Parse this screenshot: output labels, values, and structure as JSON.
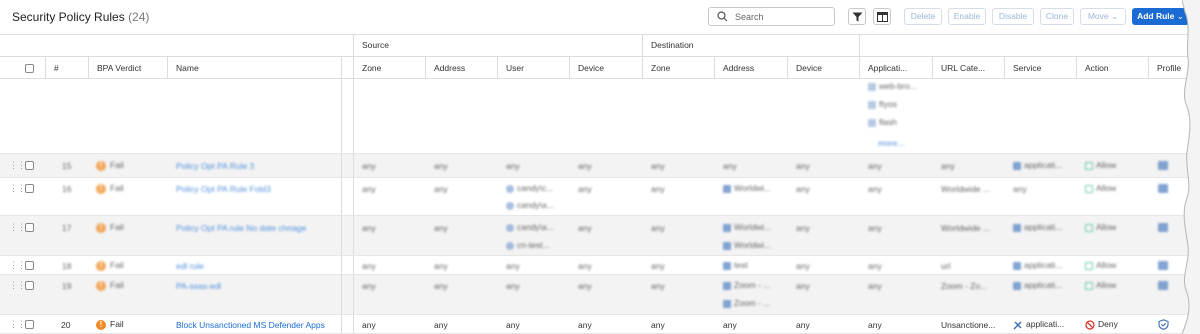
{
  "header": {
    "title": "Security Policy Rules",
    "count": "(24)",
    "search_placeholder": "Search",
    "buttons": {
      "delete": "Delete",
      "enable": "Enable",
      "disable": "Disable",
      "clone": "Clone",
      "move": "Move",
      "add_rule": "Add Rule"
    }
  },
  "groups": {
    "source": "Source",
    "destination": "Destination"
  },
  "columns": {
    "num": "#",
    "bpa": "BPA Verdict",
    "name": "Name",
    "src_zone": "Zone",
    "src_address": "Address",
    "src_user": "User",
    "src_device": "Device",
    "dst_zone": "Zone",
    "dst_address": "Address",
    "dst_device": "Device",
    "application": "Applicati...",
    "url_category": "URL Cate...",
    "service": "Service",
    "action": "Action",
    "profile": "Profile"
  },
  "overflow_row": {
    "apps": [
      "web-bro...",
      "ftyos",
      "flash"
    ],
    "more": "more..."
  },
  "rows": [
    {
      "num": "15",
      "bpa": "Fail",
      "name": "Policy Opt PA Rule 3",
      "src_zone": "any",
      "src_address": "any",
      "src_user": "any",
      "src_device": "any",
      "dst_zone": "any",
      "dst_address": "any",
      "dst_device": "any",
      "application": "any",
      "url_category": "any",
      "service": "applicati...",
      "action": "Allow"
    },
    {
      "num": "16",
      "bpa": "Fail",
      "name": "Policy Opt PA Rule Fold3",
      "src_zone": "any",
      "src_address": "any",
      "src_user": "candy\\c...",
      "src_user2": "candy\\a...",
      "src_device": "any",
      "dst_zone": "any",
      "dst_address": "Worldwi...",
      "dst_device": "any",
      "application": "any",
      "url_category": "Worldwide ...",
      "service": "any",
      "action": "Allow"
    },
    {
      "num": "17",
      "bpa": "Fail",
      "name": "Policy Opt PA rule No date chnage",
      "src_zone": "any",
      "src_address": "any",
      "src_user": "candy\\a...",
      "src_user2": "cn-test...",
      "src_device": "any",
      "dst_zone": "any",
      "dst_address": "Worldwi...",
      "dst_address2": "Worldwi...",
      "dst_device": "any",
      "application": "any",
      "url_category": "Worldwide ...",
      "service": "applicati...",
      "action": "Allow"
    },
    {
      "num": "18",
      "bpa": "Fail",
      "name": "edl rule",
      "src_zone": "any",
      "src_address": "any",
      "src_user": "any",
      "src_device": "any",
      "dst_zone": "any",
      "dst_address": "test",
      "dst_device": "any",
      "application": "any",
      "url_category": "url",
      "service": "applicati...",
      "action": "Allow"
    },
    {
      "num": "19",
      "bpa": "Fail",
      "name": "PA-ssas-edl",
      "src_zone": "any",
      "src_address": "any",
      "src_user": "any",
      "src_device": "any",
      "dst_zone": "any",
      "dst_address": "Zoom - ...",
      "dst_address2": "Zoom - ...",
      "dst_device": "any",
      "application": "any",
      "url_category": "Zoom - Zo...",
      "service": "applicati...",
      "action": "Allow"
    },
    {
      "num": "20",
      "bpa": "Fail",
      "name": "Block Unsanctioned MS Defender Apps",
      "src_zone": "any",
      "src_address": "any",
      "src_user": "any",
      "src_device": "any",
      "dst_zone": "any",
      "dst_address": "any",
      "dst_device": "any",
      "application": "any",
      "url_category": "Unsanctione...",
      "service": "applicati...",
      "action": "Deny"
    }
  ],
  "colors": {
    "accent": "#1a6cd4",
    "fail": "#f08a24",
    "deny": "#d93025",
    "allow": "#3db88a"
  }
}
